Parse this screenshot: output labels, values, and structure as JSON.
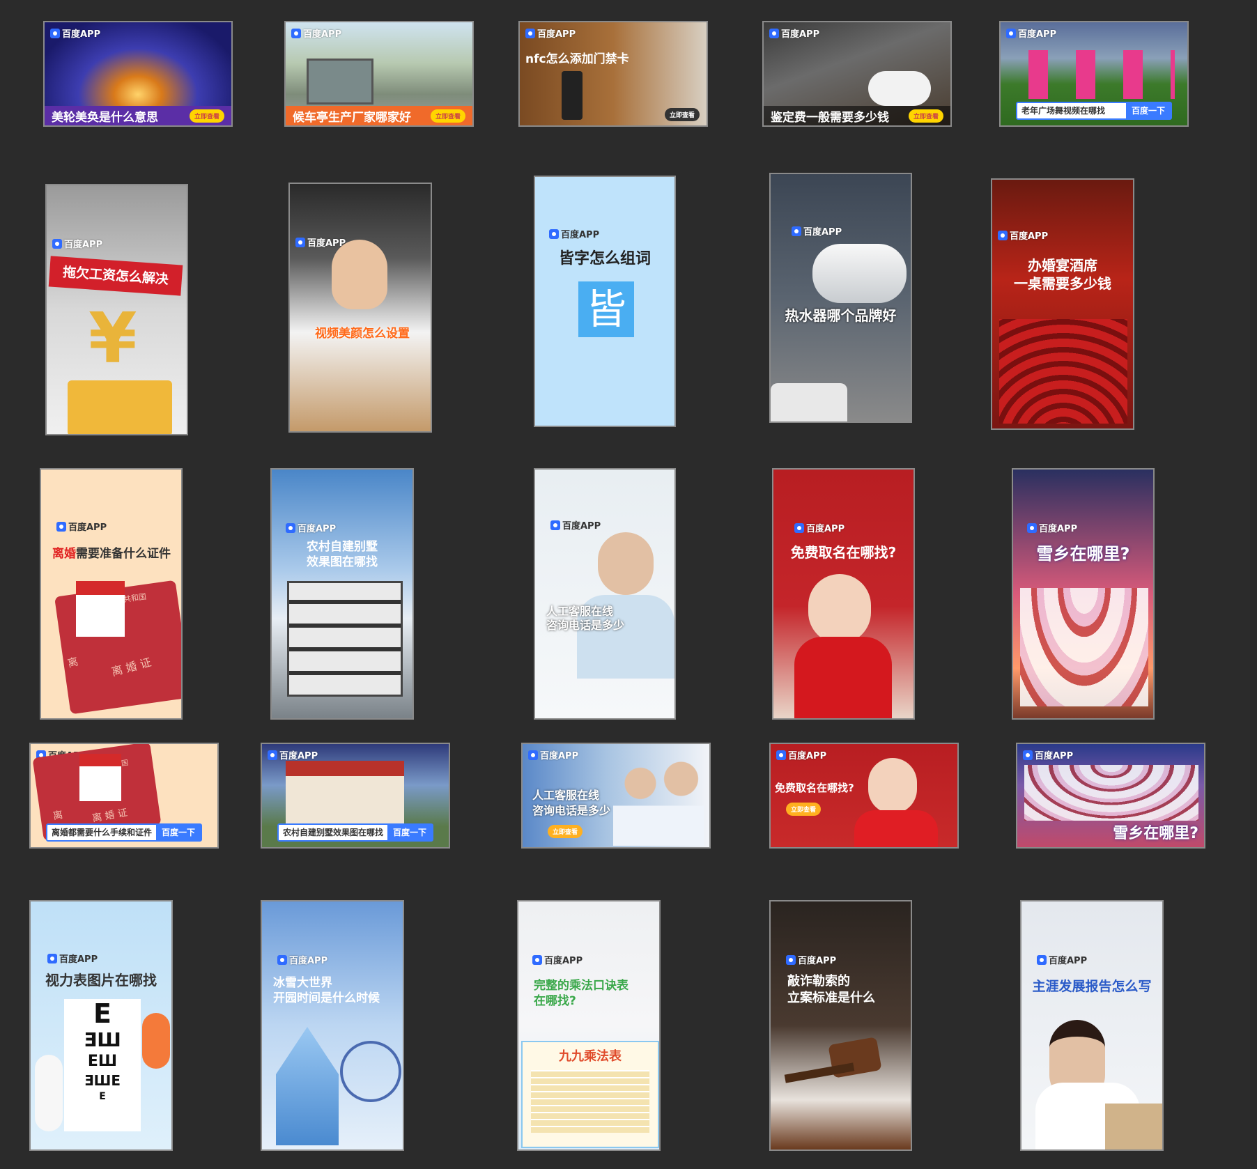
{
  "brand": "百度APP",
  "row1": [
    {
      "text": "美轮美奂是什么意思",
      "pill": "立即查看"
    },
    {
      "text": "候车亭生产厂家哪家好",
      "pill": "立即查看"
    },
    {
      "text": "nfc怎么添加门禁卡",
      "pill": "立即查看"
    },
    {
      "text": "鉴定费一般需要多少钱",
      "pill": "立即查看"
    },
    {
      "query": "老年广场舞视频在哪找",
      "button": "百度一下"
    }
  ],
  "row2": [
    {
      "text": "拖欠工资怎么解决"
    },
    {
      "text": "视频美颜怎么设置"
    },
    {
      "text": "皆字怎么组词",
      "glyph": "皆"
    },
    {
      "text": "热水器哪个品牌好"
    },
    {
      "line1": "办婚宴酒席",
      "line2": "一桌需要多少钱"
    }
  ],
  "row3": [
    {
      "text_red": "离婚",
      "text_rest": "需要准备什么证件",
      "stamp1": "共和国",
      "stamp2": "离 婚 证",
      "stamp3": "离"
    },
    {
      "line1": "农村自建别墅",
      "line2": "效果图在哪找"
    },
    {
      "line1": "人工客服在线",
      "line2": "咨询电话是多少"
    },
    {
      "text": "免费取名在哪找?"
    },
    {
      "text": "雪乡在哪里?"
    }
  ],
  "row4": [
    {
      "query": "离婚都需要什么手续和证件",
      "button": "百度一下",
      "stamp1": "共和国",
      "stamp2": "离 婚 证",
      "stamp3": "离"
    },
    {
      "query": "农村自建别墅效果图在哪找",
      "button": "百度一下"
    },
    {
      "line1": "人工客服在线",
      "line2": "咨询电话是多少",
      "pill": "立即查看"
    },
    {
      "text": "免费取名在哪找?",
      "pill": "立即查看"
    },
    {
      "text": "雪乡在哪里?"
    }
  ],
  "row5": [
    {
      "text": "视力表图片在哪找",
      "chart": [
        "E",
        "ƎШ",
        "ЕШ",
        "ƎШЕ",
        "Е"
      ]
    },
    {
      "line1": "冰雪大世界",
      "line2": "开园时间是什么时候"
    },
    {
      "line1": "完整的乘法口诀表",
      "line2": "在哪找?",
      "poster_title": "九九乘法表"
    },
    {
      "line1": "敲诈勒索的",
      "line2": "立案标准是什么"
    },
    {
      "text": "主涯发展报告怎么写"
    }
  ]
}
